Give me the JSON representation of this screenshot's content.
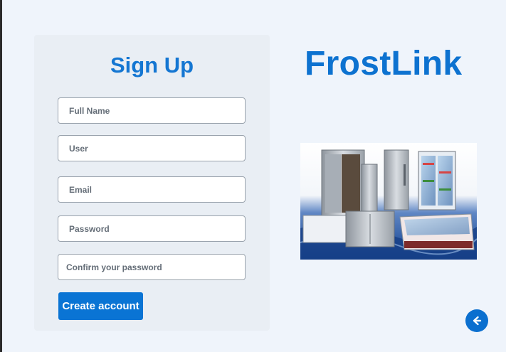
{
  "signup": {
    "title": "Sign Up",
    "fields": {
      "full_name_placeholder": "Full Name",
      "user_placeholder": "User",
      "email_placeholder": "Email",
      "password_placeholder": "Password",
      "confirm_password_placeholder": "Confirm your password"
    },
    "submit_label": "Create account"
  },
  "brand": {
    "name": "FrostLink"
  },
  "icons": {
    "back": "arrow-left-icon"
  },
  "colors": {
    "accent": "#0a74d4",
    "background": "#eff4fb",
    "card": "#e9eef4"
  }
}
